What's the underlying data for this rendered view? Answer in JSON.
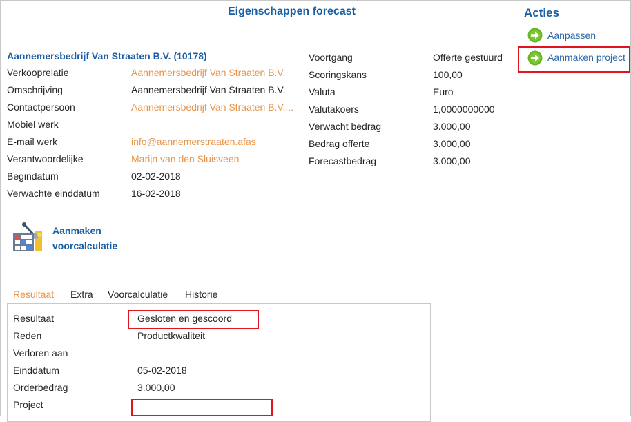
{
  "page": {
    "title": "Eigenschappen forecast"
  },
  "actions": {
    "title": "Acties",
    "items": [
      {
        "label": "Aanpassen"
      },
      {
        "label": "Aanmaken project"
      }
    ]
  },
  "relation": {
    "header": "Aannemersbedrijf Van Straaten B.V. (10178)",
    "fields": [
      {
        "label": "Verkooprelatie",
        "value": "Aannemersbedrijf Van Straaten B.V."
      },
      {
        "label": "Omschrijving",
        "value": "Aannemersbedrijf Van Straaten B.V."
      },
      {
        "label": "Contactpersoon",
        "value": "Aannemersbedrijf Van Straaten B.V...."
      },
      {
        "label": "Mobiel werk",
        "value": ""
      },
      {
        "label": "E-mail werk",
        "value": "info@aannemerstraaten.afas"
      },
      {
        "label": "Verantwoordelijke",
        "value": "Marijn van den Sluisveen"
      },
      {
        "label": "Begindatum",
        "value": "02-02-2018"
      },
      {
        "label": "Verwachte einddatum",
        "value": "16-02-2018"
      }
    ]
  },
  "forecast": {
    "fields": [
      {
        "label": "Voortgang",
        "value": "Offerte gestuurd"
      },
      {
        "label": "Scoringskans",
        "value": "100,00"
      },
      {
        "label": "Valuta",
        "value": "Euro"
      },
      {
        "label": "Valutakoers",
        "value": "1,0000000000"
      },
      {
        "label": "Verwacht bedrag",
        "value": "3.000,00"
      },
      {
        "label": "Bedrag offerte",
        "value": "3.000,00"
      },
      {
        "label": "Forecastbedrag",
        "value": "3.000,00"
      }
    ]
  },
  "calculation": {
    "label_line1": "Aanmaken",
    "label_line2": "voorcalculatie"
  },
  "tabs": [
    {
      "label": "Resultaat",
      "active": true
    },
    {
      "label": "Extra"
    },
    {
      "label": "Voorcalculatie"
    },
    {
      "label": "Historie"
    }
  ],
  "result": {
    "fields": [
      {
        "label": "Resultaat",
        "value": "Gesloten en gescoord"
      },
      {
        "label": "Reden",
        "value": "Productkwaliteit"
      },
      {
        "label": "Verloren aan",
        "value": ""
      },
      {
        "label": "Einddatum",
        "value": "05-02-2018"
      },
      {
        "label": "Orderbedrag",
        "value": "3.000,00"
      },
      {
        "label": "Project",
        "value": ""
      }
    ]
  },
  "colors": {
    "heading": "#1a5fa4",
    "link": "#e8954a",
    "action_icon": "#6ab427",
    "highlight": "#e0141e"
  },
  "icons": {
    "action": "arrow-circle-right-icon",
    "calculation": "calculator-chart-icon"
  }
}
